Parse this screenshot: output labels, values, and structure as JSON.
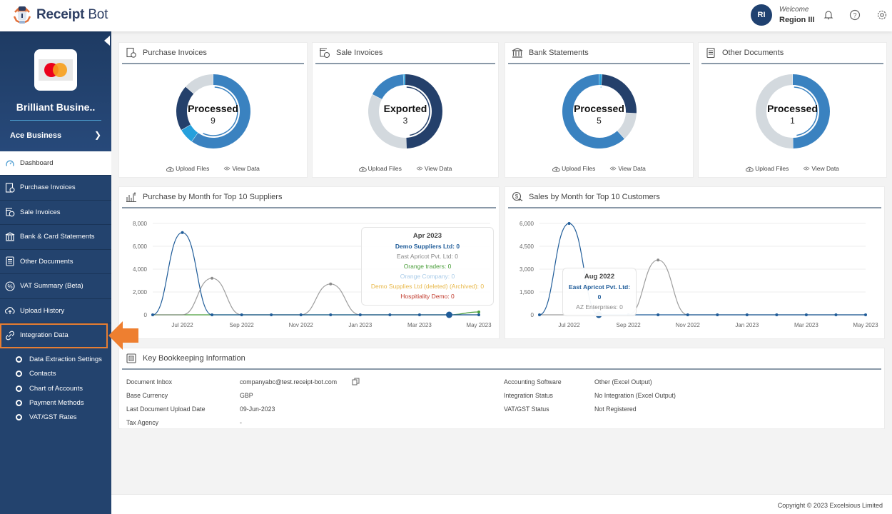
{
  "app": {
    "name_part1": "Receipt",
    "name_part2": "Bot"
  },
  "header": {
    "avatar_initials": "RI",
    "welcome": "Welcome",
    "user_name": "Region III",
    "icons": [
      "bell-icon",
      "help-icon",
      "gear-icon"
    ]
  },
  "sidebar": {
    "business_name": "Brilliant Busine..",
    "sub_business": "Ace Business",
    "items": [
      {
        "label": "Dashboard",
        "icon": "speedometer-icon",
        "active": true
      },
      {
        "label": "Purchase Invoices",
        "icon": "purchase-invoice-icon"
      },
      {
        "label": "Sale Invoices",
        "icon": "sale-invoice-icon"
      },
      {
        "label": "Bank & Card Statements",
        "icon": "bank-icon"
      },
      {
        "label": "Other Documents",
        "icon": "document-icon"
      },
      {
        "label": "VAT Summary (Beta)",
        "icon": "percent-icon"
      },
      {
        "label": "Upload History",
        "icon": "cloud-upload-icon"
      },
      {
        "label": "Integration Data",
        "icon": "link-icon",
        "highlighted": true
      }
    ],
    "sub_items": [
      "Data Extraction Settings",
      "Contacts",
      "Chart of Accounts",
      "Payment Methods",
      "VAT/GST Rates"
    ]
  },
  "cards": [
    {
      "title": "Purchase Invoices",
      "status": "Processed",
      "count": "9",
      "upload": "Upload Files",
      "view": "View Data",
      "segments": [
        {
          "v": 9,
          "c": "#3a82c0"
        },
        {
          "v": 1,
          "c": "#25a0dc"
        },
        {
          "v": 3,
          "c": "#24406b"
        },
        {
          "v": 2,
          "c": "#d3d9de"
        }
      ]
    },
    {
      "title": "Sale Invoices",
      "status": "Exported",
      "count": "3",
      "upload": "Upload Files",
      "view": "View Data",
      "segments": [
        {
          "v": 3,
          "c": "#24406b"
        },
        {
          "v": 2,
          "c": "#d3d9de"
        },
        {
          "v": 1,
          "c": "#3a82c0"
        },
        {
          "v": 0.05,
          "c": "#25a0dc"
        }
      ]
    },
    {
      "title": "Bank Statements",
      "status": "Processed",
      "count": "5",
      "upload": "Upload Files",
      "view": "View Data",
      "segments": [
        {
          "v": 0.1,
          "c": "#25a0dc"
        },
        {
          "v": 2,
          "c": "#24406b"
        },
        {
          "v": 1,
          "c": "#d3d9de"
        },
        {
          "v": 5,
          "c": "#3a82c0"
        }
      ]
    },
    {
      "title": "Other Documents",
      "status": "Processed",
      "count": "1",
      "upload": "Upload Files",
      "view": "View Data",
      "segments": [
        {
          "v": 1,
          "c": "#3a82c0"
        },
        {
          "v": 1,
          "c": "#d3d9de"
        }
      ]
    }
  ],
  "chart_data": [
    {
      "type": "line",
      "title": "Purchase by Month for Top 10 Suppliers",
      "x": [
        "Jun 2022",
        "Jul 2022",
        "Aug 2022",
        "Sep 2022",
        "Oct 2022",
        "Nov 2022",
        "Dec 2022",
        "Jan 2023",
        "Feb 2023",
        "Mar 2023",
        "Apr 2023",
        "May 2023"
      ],
      "xticks": [
        "Jul 2022",
        "Sep 2022",
        "Nov 2022",
        "Jan 2023",
        "Mar 2023",
        "May 2023"
      ],
      "yticks": [
        "0",
        "2,000",
        "4,000",
        "6,000",
        "8,000"
      ],
      "ylim": [
        0,
        8000
      ],
      "grid": true,
      "series": [
        {
          "name": "Demo Suppliers Ltd",
          "color": "#1f5c99",
          "values": [
            0,
            7200,
            0,
            0,
            0,
            0,
            0,
            0,
            0,
            0,
            0,
            0
          ]
        },
        {
          "name": "East Apricot Pvt. Ltd",
          "color": "#8c8c8c",
          "values": [
            0,
            0,
            3200,
            0,
            0,
            0,
            2700,
            0,
            0,
            0,
            0,
            0
          ]
        },
        {
          "name": "Orange traders",
          "color": "#4a9e3a",
          "values": [
            0,
            0,
            0,
            0,
            0,
            0,
            0,
            0,
            0,
            0,
            0,
            250
          ]
        }
      ],
      "tooltip": {
        "title": "Apr 2023",
        "lines": [
          {
            "text": "Demo Suppliers Ltd: 0",
            "color": "#1f5c99",
            "bold": true
          },
          {
            "text": "East Apricot Pvt. Ltd: 0",
            "color": "#888888"
          },
          {
            "text": "Orange traders: 0",
            "color": "#4a9e3a"
          },
          {
            "text": "Orange Company: 0",
            "color": "#a9cbe8"
          },
          {
            "text": "Demo Supplies Ltd (deleted) (Archived): 0",
            "color": "#e8b84a"
          },
          {
            "text": "Hospitiality Demo: 0",
            "color": "#c0392b"
          }
        ]
      },
      "highlight_index": 10
    },
    {
      "type": "line",
      "title": "Sales by Month for Top 10 Customers",
      "x": [
        "Jun 2022",
        "Jul 2022",
        "Aug 2022",
        "Sep 2022",
        "Oct 2022",
        "Nov 2022",
        "Dec 2022",
        "Jan 2023",
        "Feb 2023",
        "Mar 2023",
        "Apr 2023",
        "May 2023"
      ],
      "xticks": [
        "Jul 2022",
        "Sep 2022",
        "Nov 2022",
        "Jan 2023",
        "Mar 2023",
        "May 2023"
      ],
      "yticks": [
        "0",
        "1,500",
        "3,000",
        "4,500",
        "6,000"
      ],
      "ylim": [
        0,
        6000
      ],
      "grid": true,
      "series": [
        {
          "name": "East Apricot Pvt. Ltd",
          "color": "#1f5c99",
          "values": [
            0,
            6000,
            0,
            0,
            0,
            0,
            0,
            0,
            0,
            0,
            0,
            0
          ]
        },
        {
          "name": "AZ Enterprises",
          "color": "#8c8c8c",
          "values": [
            0,
            0,
            0,
            0,
            3600,
            0,
            0,
            0,
            0,
            0,
            0,
            0
          ]
        }
      ],
      "tooltip": {
        "title": "Aug 2022",
        "lines": [
          {
            "text": "East Apricot Pvt. Ltd: 0",
            "color": "#1f5c99",
            "bold": true
          },
          {
            "text": "AZ Enterprises: 0",
            "color": "#888888"
          }
        ]
      },
      "highlight_index": 2
    }
  ],
  "bookkeeping": {
    "title": "Key Bookkeeping Information",
    "left": [
      {
        "label": "Document Inbox",
        "value": "companyabc@test.receipt-bot.com"
      },
      {
        "label": "Base Currency",
        "value": "GBP"
      },
      {
        "label": "Last Document Upload Date",
        "value": "09-Jun-2023"
      },
      {
        "label": "Tax Agency",
        "value": "-"
      }
    ],
    "right": [
      {
        "label": "Accounting Software",
        "value": "Other (Excel Output)"
      },
      {
        "label": "Integration Status",
        "value": "No Integration (Excel Output)"
      },
      {
        "label": "VAT/GST Status",
        "value": "Not Registered"
      }
    ]
  },
  "footer": {
    "copyright": "Copyright © 2023 Excelsious Limited"
  }
}
